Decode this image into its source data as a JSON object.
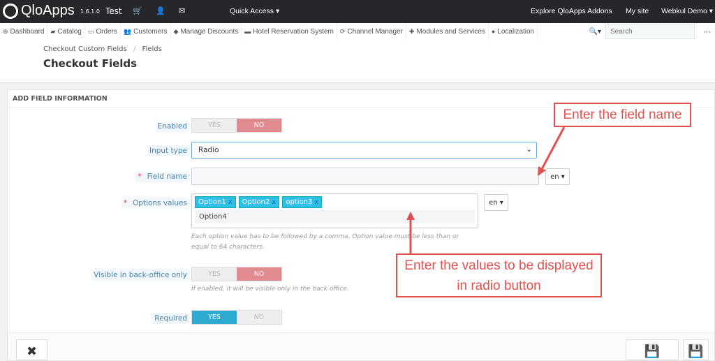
{
  "topbar": {
    "brand": "QloApps",
    "version": "1.6.1.0",
    "shop": "Test",
    "quick_access": "Quick Access ▾",
    "addons": "Explore QloApps Addons",
    "my_site": "My site",
    "user": "Webkul Demo ▾"
  },
  "nav": {
    "items": [
      {
        "icon": "⊛",
        "label": "Dashboard"
      },
      {
        "icon": "▰",
        "label": "Catalog"
      },
      {
        "icon": "▭",
        "label": "Orders"
      },
      {
        "icon": "👥",
        "label": "Customers"
      },
      {
        "icon": "◆",
        "label": "Manage Discounts"
      },
      {
        "icon": "▬",
        "label": "Hotel Reservation System"
      },
      {
        "icon": "⟳",
        "label": "Channel Manager"
      },
      {
        "icon": "✚",
        "label": "Modules and Services"
      },
      {
        "icon": "●",
        "label": "Localization"
      }
    ],
    "search_placeholder": "Search"
  },
  "header": {
    "breadcrumb": [
      "Checkout Custom Fields",
      "Fields"
    ],
    "title": "Checkout Fields"
  },
  "panel": {
    "title": "ADD FIELD INFORMATION",
    "enabled": {
      "label": "Enabled",
      "yes": "YES",
      "no": "NO",
      "value": "no"
    },
    "input_type": {
      "label": "Input type",
      "value": "Radio"
    },
    "field_name": {
      "label": "Field name",
      "value": "",
      "lang": "en ▾"
    },
    "options": {
      "label": "Options values",
      "tags": [
        "Option1",
        "Option2",
        "option3"
      ],
      "suggestion": "Option4",
      "lang": "en ▾",
      "help": "Each option value has to be followed by a comma.   Option value must be less than or equal to 64 characters."
    },
    "visible_bo": {
      "label": "Visible in back-office only",
      "yes": "YES",
      "no": "NO",
      "value": "no",
      "help": "If enabled, it will be visible only in the back office."
    },
    "required": {
      "label": "Required",
      "yes": "YES",
      "no": "NO",
      "value": "yes"
    }
  },
  "annotations": {
    "field_name": "Enter the field name",
    "values_line1": "Enter the values to be displayed",
    "values_line2": "in radio button"
  },
  "colors": {
    "annotation": "#e2514f",
    "accent": "#2eaad1",
    "no_active": "#e18a8f"
  }
}
